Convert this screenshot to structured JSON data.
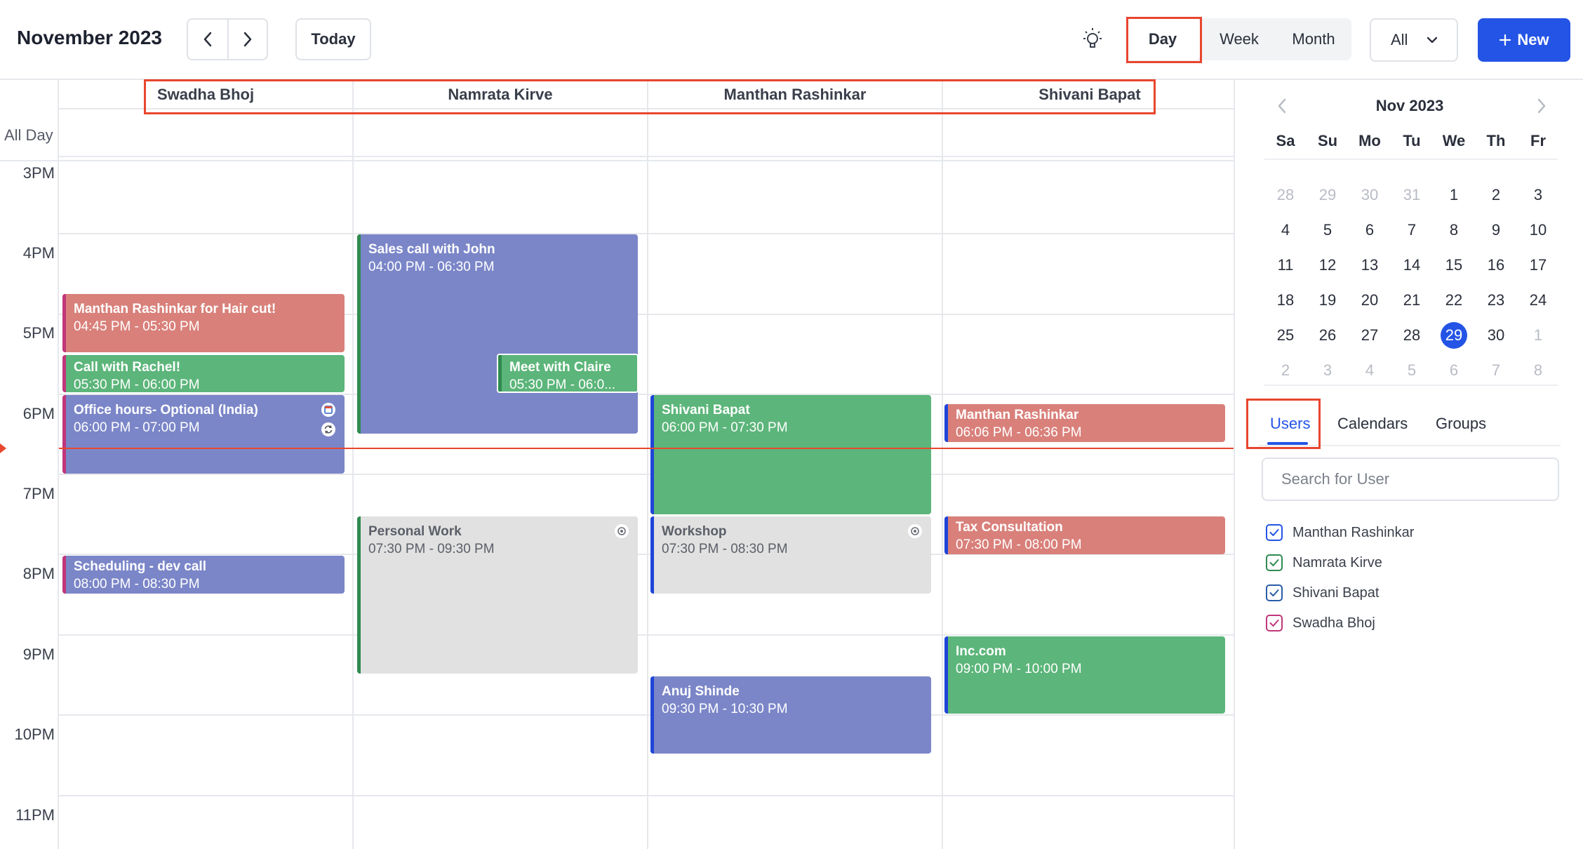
{
  "header": {
    "month_title": "November 2023",
    "today_label": "Today",
    "views": {
      "day": "Day",
      "week": "Week",
      "month": "Month"
    },
    "active_view": "Day",
    "filter_value": "All",
    "new_label": "New",
    "accent": "#2454e6"
  },
  "calendar": {
    "all_day_label": "All Day",
    "columns": [
      "Swadha Bhoj",
      "Namrata Kirve",
      "Manthan Rashinkar",
      "Shivani Bapat"
    ],
    "hours": [
      "3PM",
      "4PM",
      "5PM",
      "6PM",
      "7PM",
      "8PM",
      "9PM",
      "10PM",
      "11PM"
    ],
    "events": [
      {
        "title": "Manthan Rashinkar for Hair cut!",
        "time": "04:45 PM - 05:30 PM"
      },
      {
        "title": "Call with Rachel!",
        "time": "05:30 PM - 06:00 PM"
      },
      {
        "title": "Office hours- Optional (India)",
        "time": "06:00 PM - 07:00 PM"
      },
      {
        "title": "Scheduling - dev call",
        "time": "08:00 PM - 08:30 PM"
      },
      {
        "title": "Sales call with John",
        "time": "04:00 PM - 06:30 PM"
      },
      {
        "title": "Meet with Claire",
        "time": "05:30 PM - 06:0..."
      },
      {
        "title": "Personal Work",
        "time": "07:30 PM - 09:30 PM"
      },
      {
        "title": "Shivani Bapat",
        "time": "06:00 PM - 07:30 PM"
      },
      {
        "title": "Workshop",
        "time": "07:30 PM - 08:30 PM"
      },
      {
        "title": "Anuj Shinde",
        "time": "09:30 PM - 10:30 PM"
      },
      {
        "title": "Manthan Rashinkar",
        "time": "06:06 PM - 06:36 PM"
      },
      {
        "title": "Tax Consultation",
        "time": "07:30 PM - 08:00 PM"
      },
      {
        "title": "Inc.com",
        "time": "09:00 PM - 10:00 PM"
      }
    ]
  },
  "mini_calendar": {
    "title": "Nov 2023",
    "weekdays": [
      "Sa",
      "Su",
      "Mo",
      "Tu",
      "We",
      "Th",
      "Fr"
    ],
    "weeks": [
      [
        "28",
        "29",
        "30",
        "31",
        "1",
        "2",
        "3"
      ],
      [
        "4",
        "5",
        "6",
        "7",
        "8",
        "9",
        "10"
      ],
      [
        "11",
        "12",
        "13",
        "14",
        "15",
        "16",
        "17"
      ],
      [
        "18",
        "19",
        "20",
        "21",
        "22",
        "23",
        "24"
      ],
      [
        "25",
        "26",
        "27",
        "28",
        "29",
        "30",
        "1"
      ],
      [
        "2",
        "3",
        "4",
        "5",
        "6",
        "7",
        "8"
      ]
    ],
    "selected": "29"
  },
  "panel": {
    "tabs": [
      "Users",
      "Calendars",
      "Groups"
    ],
    "active_tab": "Users",
    "search_placeholder": "Search for User",
    "users": [
      {
        "name": "Manthan Rashinkar",
        "color": "#2454e6"
      },
      {
        "name": "Namrata Kirve",
        "color": "#2f8a4f"
      },
      {
        "name": "Shivani Bapat",
        "color": "#2a5ca8"
      },
      {
        "name": "Swadha Bhoj",
        "color": "#c1367a"
      }
    ]
  }
}
